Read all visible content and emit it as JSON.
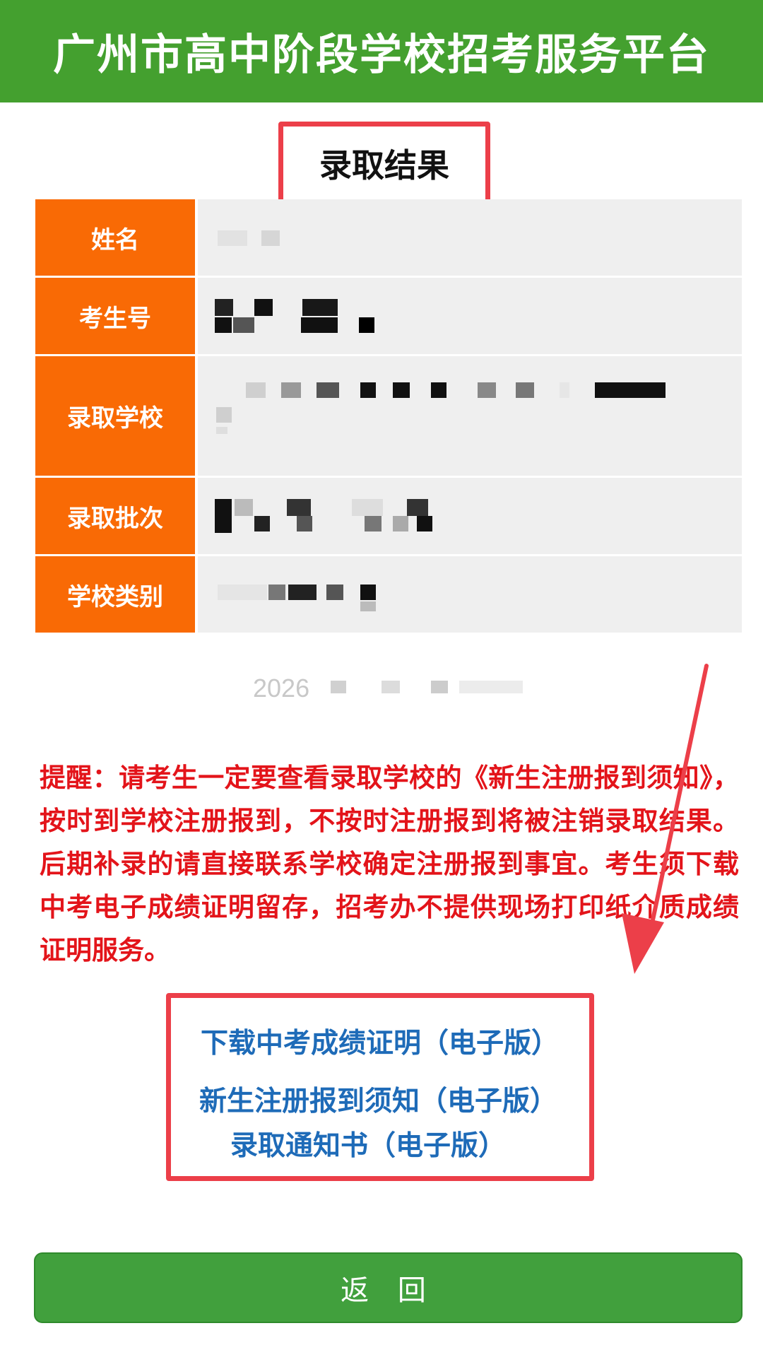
{
  "header": {
    "title": "广州市高中阶段学校招考服务平台"
  },
  "result_title": "录取结果",
  "fields": [
    {
      "label": "姓名"
    },
    {
      "label": "考生号"
    },
    {
      "label": "录取学校"
    },
    {
      "label": "录取批次"
    },
    {
      "label": "学校类别"
    }
  ],
  "date_prefix": "2026",
  "reminder": "提醒：请考生一定要查看录取学校的《新生注册报到须知》，按时到学校注册报到，不按时注册报到将被注销录取结果。后期补录的请直接联系学校确定注册报到事宜。考生须下载中考电子成绩证明留存，招考办不提供现场打印纸介质成绩证明服务。",
  "links": {
    "score_certificate": "下载中考成绩证明（电子版）",
    "registration_notice": "新生注册报到须知（电子版）",
    "admission_letter": "录取通知书（电子版）"
  },
  "back_button": "返 回",
  "colors": {
    "header_green": "#44a02f",
    "label_orange": "#f96a05",
    "highlight_red": "#ec3f49",
    "reminder_red": "#e3141a",
    "link_blue": "#1e6bb8",
    "button_green": "#41a03d"
  }
}
